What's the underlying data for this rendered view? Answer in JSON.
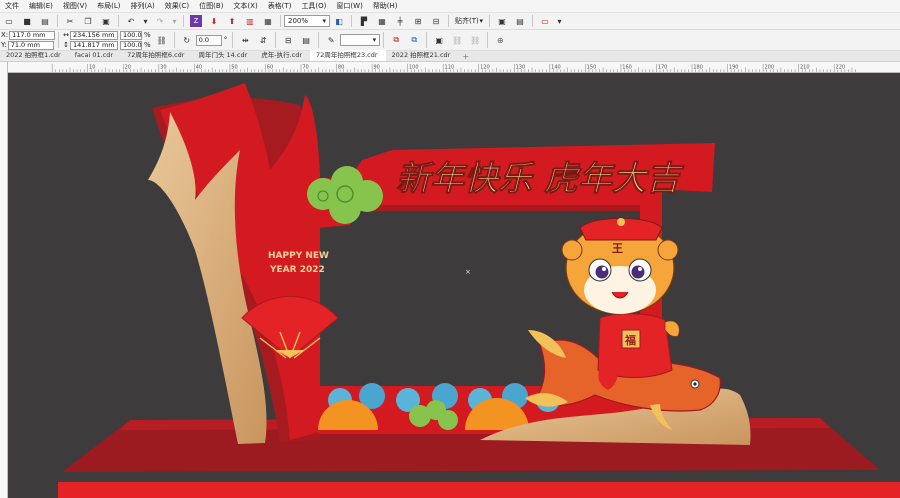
{
  "menu": [
    "文件",
    "编辑(E)",
    "视图(V)",
    "布局(L)",
    "排列(A)",
    "效果(C)",
    "位图(B)",
    "文本(X)",
    "表格(T)",
    "工具(O)",
    "窗口(W)",
    "帮助(H)"
  ],
  "toolbar": {
    "zoom": "200%",
    "snap_label": "贴齐(T)",
    "x": "117.0 mm",
    "y": "71.0 mm",
    "width": "234.156 mm",
    "height": "141.817 mm",
    "scale_w": "100.0",
    "scale_h": "100.0",
    "percent": "%",
    "rotation": "0.0",
    "degree": "°",
    "outline_width": ""
  },
  "tabs": [
    "2022 拍照框1.cdr",
    "facai 01.cdr",
    "72周年拍照框6.cdr",
    "周年门头 14.cdr",
    "虎年-执行.cdr",
    "72周年拍照框23.cdr",
    "2022 拍照框21.cdr"
  ],
  "active_tab": 5,
  "ruler": [
    "10",
    "20",
    "30",
    "40",
    "50",
    "60",
    "70",
    "80",
    "90",
    "100",
    "110",
    "120",
    "130",
    "140",
    "150",
    "160",
    "170",
    "180",
    "190",
    "200",
    "210",
    "220"
  ],
  "artwork": {
    "headline": "新年快乐 虎年大吉",
    "sub_line1": "HAPPY NEW",
    "sub_line2": "YEAR 2022",
    "badge": "王",
    "coin": "福"
  },
  "colors": {
    "canvas": "#3d3b3b",
    "red": "#d31a21",
    "dark_red": "#9b1b21",
    "gold": "#d7b07a",
    "green": "#87c44e",
    "orange": "#f29322",
    "gold_text": "#f3d09a"
  }
}
